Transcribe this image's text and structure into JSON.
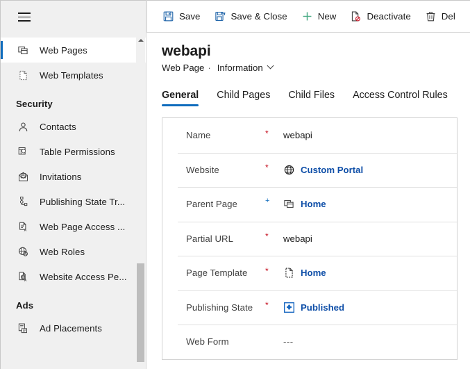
{
  "colors": {
    "accent": "#0f6cbd",
    "link": "#0f4fa8",
    "required": "#c50f1f",
    "sidebar_bg": "#f0f0f0",
    "text": "#1b1b1b",
    "muted": "#424242",
    "border": "#d1d1d1",
    "scroll_thumb": "#bdbdbd"
  },
  "sidebar": {
    "menu_icon": "hamburger-icon",
    "items": [
      {
        "label": "Web Pages",
        "icon": "web-pages-icon",
        "selected": true,
        "type": "item"
      },
      {
        "label": "Web Templates",
        "icon": "web-templates-icon",
        "selected": false,
        "type": "item"
      },
      {
        "label": "Security",
        "icon": "",
        "selected": false,
        "type": "group"
      },
      {
        "label": "Contacts",
        "icon": "contact-icon",
        "selected": false,
        "type": "item"
      },
      {
        "label": "Table  Permissions",
        "icon": "table-permissions-icon",
        "selected": false,
        "type": "item"
      },
      {
        "label": "Invitations",
        "icon": "invitations-icon",
        "selected": false,
        "type": "item"
      },
      {
        "label": "Publishing State Tr...",
        "icon": "publishing-state-transition-icon",
        "selected": false,
        "type": "item"
      },
      {
        "label": "Web Page Access ...",
        "icon": "web-page-access-icon",
        "selected": false,
        "type": "item"
      },
      {
        "label": "Web Roles",
        "icon": "web-roles-icon",
        "selected": false,
        "type": "item"
      },
      {
        "label": "Website Access Pe...",
        "icon": "website-access-permission-icon",
        "selected": false,
        "type": "item"
      },
      {
        "label": "Ads",
        "icon": "",
        "selected": false,
        "type": "group"
      },
      {
        "label": "Ad Placements",
        "icon": "ad-placements-icon",
        "selected": false,
        "type": "item"
      }
    ],
    "scrollbar": {
      "up_arrow": "scroll-up-arrow-icon"
    }
  },
  "command_bar": {
    "buttons": [
      {
        "label": "Save",
        "icon": "save-icon"
      },
      {
        "label": "Save & Close",
        "icon": "save-and-close-icon"
      },
      {
        "label": "New",
        "icon": "plus-icon"
      },
      {
        "label": "Deactivate",
        "icon": "deactivate-icon"
      },
      {
        "label": "Del",
        "icon": "delete-trash-icon"
      }
    ]
  },
  "header": {
    "title": "webapi",
    "entity": "Web Page",
    "separator": "·",
    "form_name": "Information",
    "chevron": "chevron-down-icon"
  },
  "tabs": [
    {
      "label": "General",
      "active": true
    },
    {
      "label": "Child Pages",
      "active": false
    },
    {
      "label": "Child Files",
      "active": false
    },
    {
      "label": "Access Control Rules",
      "active": false
    }
  ],
  "form": {
    "fields": [
      {
        "label": "Name",
        "required": "*",
        "required_type": "star",
        "value": "webapi",
        "value_type": "text",
        "icon": ""
      },
      {
        "label": "Website",
        "required": "*",
        "required_type": "star",
        "value": "Custom Portal",
        "value_type": "link",
        "icon": "globe-icon"
      },
      {
        "label": "Parent Page",
        "required": "+",
        "required_type": "plus",
        "value": "Home",
        "value_type": "link",
        "icon": "web-pages-icon"
      },
      {
        "label": "Partial URL",
        "required": "*",
        "required_type": "star",
        "value": "webapi",
        "value_type": "text",
        "icon": ""
      },
      {
        "label": "Page Template",
        "required": "*",
        "required_type": "star",
        "value": "Home",
        "value_type": "link",
        "icon": "page-template-icon"
      },
      {
        "label": "Publishing State",
        "required": "*",
        "required_type": "star",
        "value": "Published",
        "value_type": "link",
        "icon": "publishing-state-icon"
      },
      {
        "label": "Web Form",
        "required": "",
        "required_type": "none",
        "value": "---",
        "value_type": "empty",
        "icon": ""
      }
    ]
  }
}
